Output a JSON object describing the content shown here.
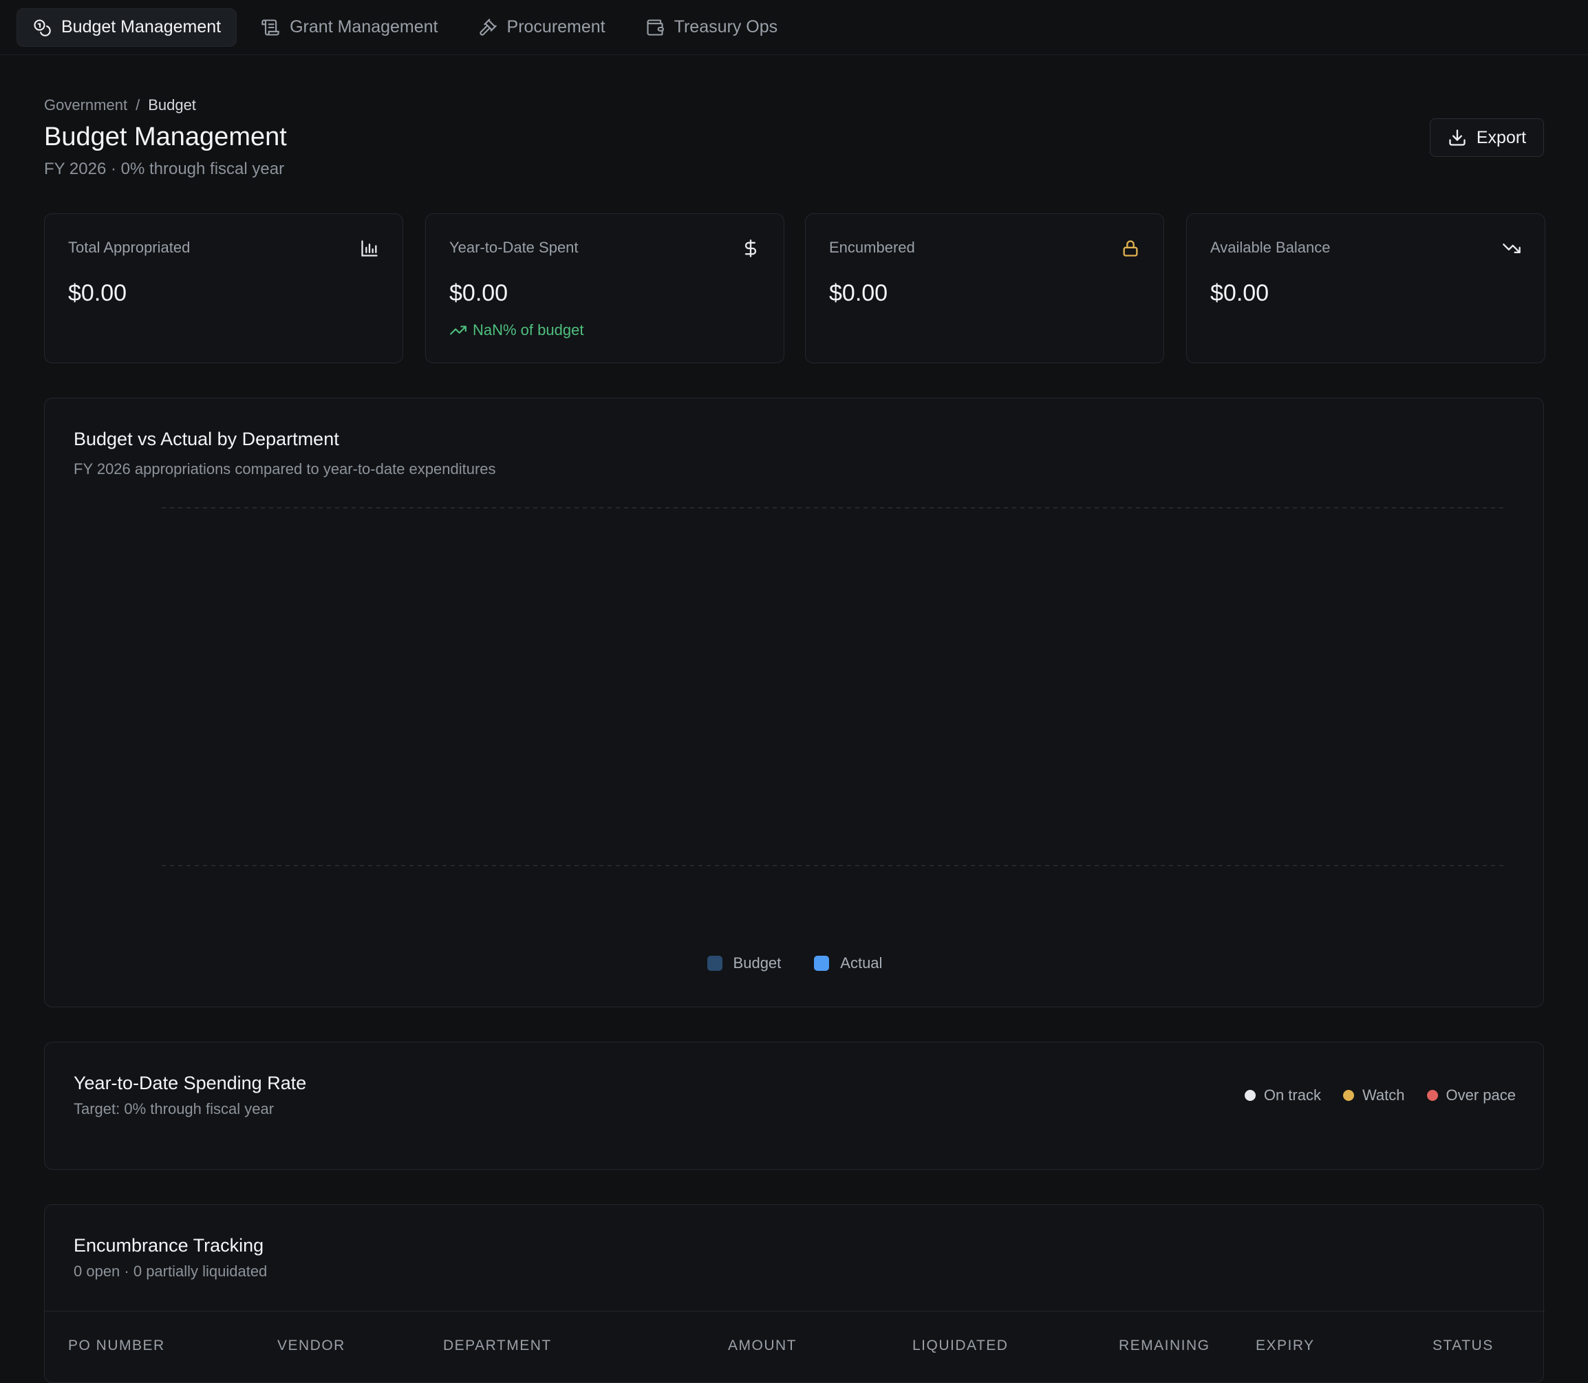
{
  "nav": {
    "tabs": [
      {
        "label": "Budget Management",
        "active": true,
        "icon": "coins-icon"
      },
      {
        "label": "Grant Management",
        "active": false,
        "icon": "scroll-icon"
      },
      {
        "label": "Procurement",
        "active": false,
        "icon": "gavel-icon"
      },
      {
        "label": "Treasury Ops",
        "active": false,
        "icon": "wallet-icon"
      }
    ]
  },
  "breadcrumb": {
    "parent": "Government",
    "separator": "/",
    "current": "Budget"
  },
  "header": {
    "title": "Budget Management",
    "subtitle": "FY 2026 · 0% through fiscal year",
    "export_label": "Export"
  },
  "kpis": [
    {
      "label": "Total Appropriated",
      "value": "$0.00",
      "icon": "bar-chart-icon"
    },
    {
      "label": "Year-to-Date Spent",
      "value": "$0.00",
      "icon": "dollar-icon",
      "trend": "NaN% of budget"
    },
    {
      "label": "Encumbered",
      "value": "$0.00",
      "icon": "lock-icon"
    },
    {
      "label": "Available Balance",
      "value": "$0.00",
      "icon": "trending-down-icon"
    }
  ],
  "chart_card": {
    "title": "Budget vs Actual by Department",
    "subtitle": "FY 2026 appropriations compared to year-to-date expenditures"
  },
  "chart_data": {
    "type": "bar",
    "title": "Budget vs Actual by Department",
    "categories": [],
    "series": [
      {
        "name": "Budget",
        "values": [],
        "color": "#2a4a6e"
      },
      {
        "name": "Actual",
        "values": [],
        "color": "#4f9cf5"
      }
    ],
    "grid": true,
    "legend": "bottom-center"
  },
  "rate_card": {
    "title": "Year-to-Date Spending Rate",
    "subtitle": "Target: 0% through fiscal year",
    "legend": [
      {
        "label": "On track",
        "color": "#e8eaed"
      },
      {
        "label": "Watch",
        "color": "#e0b24f"
      },
      {
        "label": "Over pace",
        "color": "#e0625f"
      }
    ]
  },
  "encumbrance": {
    "title": "Encumbrance Tracking",
    "subtitle": "0 open · 0 partially liquidated",
    "columns": [
      "PO NUMBER",
      "VENDOR",
      "DEPARTMENT",
      "AMOUNT",
      "LIQUIDATED",
      "REMAINING",
      "EXPIRY",
      "STATUS"
    ]
  },
  "colors": {
    "accent_green": "#4fbf7f",
    "lock_amber": "#e0b24f"
  }
}
